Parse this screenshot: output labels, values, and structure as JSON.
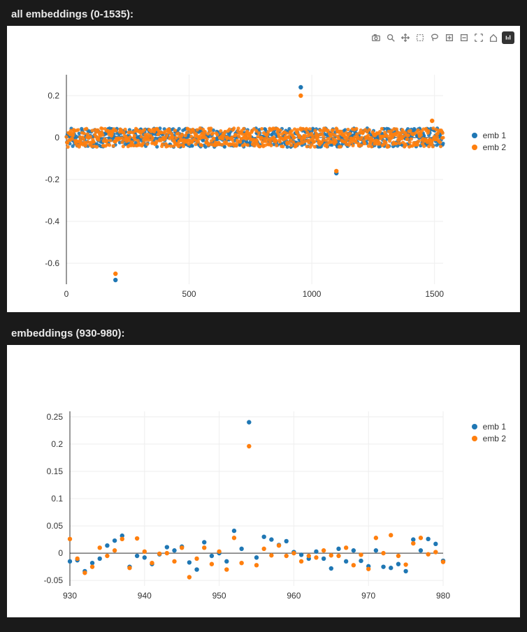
{
  "sections": {
    "top": {
      "title": "all embeddings (0-1535):"
    },
    "bottom": {
      "title": "embeddings (930-980):"
    }
  },
  "toolbar_icons": [
    "camera",
    "zoom",
    "pan",
    "box-select",
    "lasso",
    "zoom-in",
    "zoom-out",
    "autoscale",
    "reset",
    "logo"
  ],
  "legend": {
    "series1": {
      "label": "emb 1",
      "color": "#1f77b4"
    },
    "series2": {
      "label": "emb 2",
      "color": "#ff7f0e"
    }
  },
  "chart_data": [
    {
      "type": "scatter",
      "title": "all embeddings (0-1535):",
      "xlabel": "",
      "ylabel": "",
      "xlim": [
        0,
        1535
      ],
      "ylim": [
        -0.7,
        0.3
      ],
      "xticks": [
        0,
        500,
        1000,
        1500
      ],
      "yticks": [
        -0.6,
        -0.4,
        -0.2,
        0,
        0.2
      ],
      "series": [
        {
          "name": "emb 1",
          "color": "#1f77b4",
          "note": "1536 points, majority in [-0.05,0.05]",
          "outliers": [
            {
              "x": 200,
              "y": -0.68
            },
            {
              "x": 955,
              "y": 0.24
            },
            {
              "x": 1100,
              "y": -0.17
            }
          ]
        },
        {
          "name": "emb 2",
          "color": "#ff7f0e",
          "note": "1536 points, majority in [-0.05,0.05]",
          "outliers": [
            {
              "x": 200,
              "y": -0.65
            },
            {
              "x": 955,
              "y": 0.2
            },
            {
              "x": 1100,
              "y": -0.16
            },
            {
              "x": 1490,
              "y": 0.08
            }
          ]
        }
      ]
    },
    {
      "type": "scatter",
      "title": "embeddings (930-980):",
      "xlabel": "",
      "ylabel": "",
      "xlim": [
        930,
        980
      ],
      "ylim": [
        -0.06,
        0.26
      ],
      "xticks": [
        930,
        940,
        950,
        960,
        970,
        980
      ],
      "yticks": [
        -0.05,
        0,
        0.05,
        0.1,
        0.15,
        0.2,
        0.25
      ],
      "series": [
        {
          "name": "emb 1",
          "color": "#1f77b4",
          "x_values": [
            930,
            931,
            932,
            933,
            934,
            935,
            936,
            937,
            938,
            939,
            940,
            941,
            942,
            943,
            944,
            945,
            946,
            947,
            948,
            949,
            950,
            951,
            952,
            953,
            954,
            955,
            956,
            957,
            958,
            959,
            960,
            961,
            962,
            963,
            964,
            965,
            966,
            967,
            968,
            969,
            970,
            971,
            972,
            973,
            974,
            975,
            976,
            977,
            978,
            979,
            980
          ],
          "y_values": [
            -0.015,
            -0.013,
            -0.033,
            -0.018,
            -0.01,
            0.014,
            0.023,
            0.032,
            -0.025,
            -0.005,
            -0.008,
            -0.02,
            -0.002,
            0.011,
            0.005,
            0.012,
            -0.017,
            -0.03,
            0.02,
            -0.005,
            0.0,
            -0.015,
            0.041,
            0.008,
            0.24,
            -0.008,
            0.03,
            0.025,
            0.015,
            0.022,
            0.002,
            -0.003,
            -0.01,
            0.003,
            -0.01,
            -0.028,
            0.008,
            -0.015,
            0.005,
            -0.014,
            -0.024,
            0.005,
            -0.025,
            -0.027,
            -0.02,
            -0.033,
            0.025,
            0.005,
            0.026,
            0.017,
            -0.014
          ]
        },
        {
          "name": "emb 2",
          "color": "#ff7f0e",
          "x_values": [
            930,
            931,
            932,
            933,
            934,
            935,
            936,
            937,
            938,
            939,
            940,
            941,
            942,
            943,
            944,
            945,
            946,
            947,
            948,
            949,
            950,
            951,
            952,
            953,
            954,
            955,
            956,
            957,
            958,
            959,
            960,
            961,
            962,
            963,
            964,
            965,
            966,
            967,
            968,
            969,
            970,
            971,
            972,
            973,
            974,
            975,
            976,
            977,
            978,
            979,
            980
          ],
          "y_values": [
            0.026,
            -0.01,
            -0.036,
            -0.025,
            0.01,
            -0.005,
            0.005,
            0.026,
            -0.027,
            0.027,
            0.003,
            -0.018,
            -0.001,
            0.0,
            -0.015,
            0.01,
            -0.044,
            -0.01,
            0.01,
            -0.02,
            0.003,
            -0.03,
            0.028,
            -0.018,
            0.196,
            -0.022,
            0.008,
            -0.004,
            0.014,
            -0.005,
            0.0,
            -0.015,
            -0.005,
            -0.008,
            0.005,
            -0.004,
            -0.005,
            0.01,
            -0.022,
            -0.003,
            -0.029,
            0.028,
            0.0,
            0.033,
            -0.005,
            -0.021,
            0.018,
            0.028,
            -0.002,
            0.002,
            -0.016
          ]
        }
      ]
    }
  ]
}
